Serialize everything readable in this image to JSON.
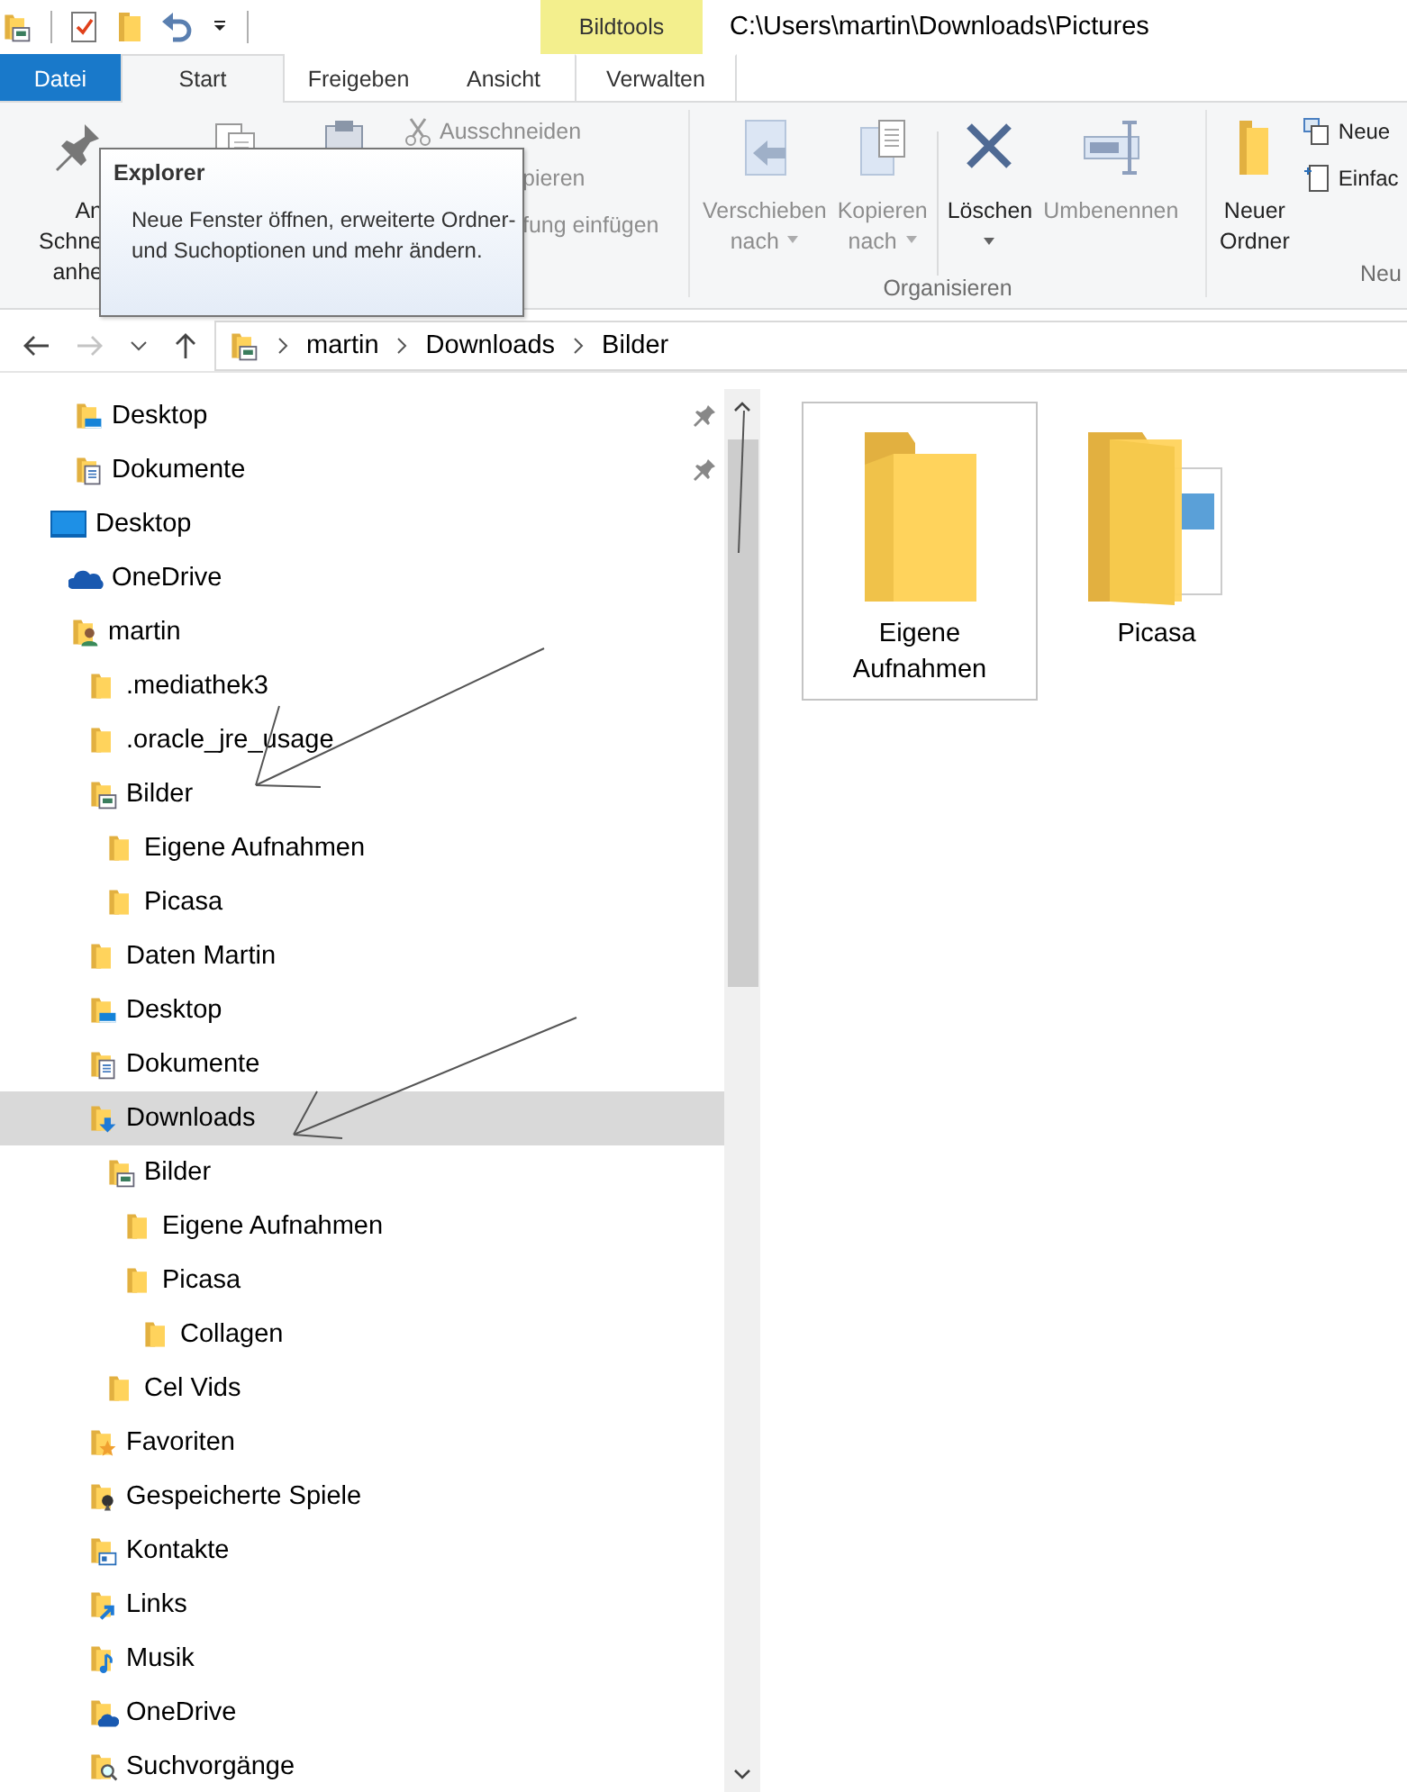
{
  "window": {
    "title": "C:\\Users\\martin\\Downloads\\Pictures"
  },
  "contextual_tab": {
    "label": "Bildtools"
  },
  "ribbon_tabs": [
    {
      "kind": "file",
      "label": "Datei",
      "selected": false
    },
    {
      "kind": "tab",
      "label": "Start",
      "selected": true
    },
    {
      "kind": "tab",
      "label": "Freigeben",
      "selected": false
    },
    {
      "kind": "tab",
      "label": "Ansicht",
      "selected": false
    },
    {
      "kind": "contextual",
      "label": "Verwalten",
      "selected": false
    }
  ],
  "ribbon": {
    "groups": [
      {
        "commands": [
          {
            "kind": "large",
            "label": "An Schne\nanhe",
            "disabled": false
          },
          {
            "kind": "large"
          },
          {
            "kind": "large"
          },
          {
            "kind": "stack",
            "items": [
              {
                "label": "Ausschneiden",
                "disabled": true
              },
              {
                "label": "pieren",
                "disabled": true
              },
              {
                "label": "fung einfügen",
                "disabled": true
              }
            ]
          }
        ]
      },
      {
        "label": "Organisieren",
        "commands": [
          {
            "kind": "large",
            "label": "Verschieben\nnach",
            "dropdown": true,
            "disabled": true
          },
          {
            "kind": "large",
            "label": "Kopieren\nnach",
            "dropdown": true,
            "disabled": true
          },
          {
            "kind": "separator"
          },
          {
            "kind": "large",
            "label": "Löschen",
            "dropdown": true,
            "disabled": false
          },
          {
            "kind": "large",
            "label": "Umbenennen",
            "disabled": true
          }
        ]
      },
      {
        "label": "Neu",
        "commands": [
          {
            "kind": "large",
            "label": "Neuer\nOrdner",
            "disabled": false
          },
          {
            "kind": "stack",
            "items": [
              {
                "label": "Neue",
                "disabled": false
              },
              {
                "label": "Einfac",
                "disabled": false
              }
            ]
          }
        ]
      }
    ]
  },
  "tooltip": {
    "title": "Explorer",
    "text": "Neue Fenster öffnen, erweiterte Ordner- und Suchoptionen und mehr ändern."
  },
  "navigation": {
    "back_disabled": false,
    "forward_disabled": true,
    "breadcrumbs": [
      "martin",
      "Downloads",
      "Bilder"
    ]
  },
  "nav_pane": {
    "quick_access": [
      {
        "label": "Desktop",
        "kind": "desktop-folder",
        "pinned": true,
        "selected": false
      },
      {
        "label": "Dokumente",
        "kind": "documents-folder",
        "pinned": true,
        "selected": false
      }
    ],
    "tree": [
      {
        "label": "Desktop",
        "kind": "monitor",
        "selected": false,
        "children": [
          {
            "label": "OneDrive",
            "kind": "cloud",
            "selected": false
          },
          {
            "label": "martin",
            "kind": "user-folder",
            "selected": false,
            "children": [
              {
                "label": ".mediathek3",
                "kind": "folder",
                "selected": false
              },
              {
                "label": ".oracle_jre_usage",
                "kind": "folder",
                "selected": false
              },
              {
                "label": "Bilder",
                "kind": "pictures-folder",
                "selected": false,
                "children": [
                  {
                    "label": "Eigene Aufnahmen",
                    "kind": "folder",
                    "selected": false
                  },
                  {
                    "label": "Picasa",
                    "kind": "folder",
                    "selected": false
                  }
                ]
              },
              {
                "label": "Daten Martin",
                "kind": "folder",
                "selected": false
              },
              {
                "label": "Desktop",
                "kind": "desktop-folder",
                "selected": false
              },
              {
                "label": "Dokumente",
                "kind": "documents-folder",
                "selected": false
              },
              {
                "label": "Downloads",
                "kind": "downloads-folder",
                "selected": true,
                "children": [
                  {
                    "label": "Bilder",
                    "kind": "pictures-folder",
                    "selected": false,
                    "children": [
                      {
                        "label": "Eigene Aufnahmen",
                        "kind": "folder",
                        "selected": false
                      },
                      {
                        "label": "Picasa",
                        "kind": "folder",
                        "selected": false,
                        "children": [
                          {
                            "label": "Collagen",
                            "kind": "folder",
                            "selected": false
                          }
                        ]
                      }
                    ]
                  },
                  {
                    "label": "Cel Vids",
                    "kind": "folder",
                    "selected": false
                  }
                ]
              },
              {
                "label": "Favoriten",
                "kind": "favorites-folder",
                "selected": false
              },
              {
                "label": "Gespeicherte Spiele",
                "kind": "games-folder",
                "selected": false
              },
              {
                "label": "Kontakte",
                "kind": "contacts-folder",
                "selected": false
              },
              {
                "label": "Links",
                "kind": "links-folder",
                "selected": false
              },
              {
                "label": "Musik",
                "kind": "music-folder",
                "selected": false
              },
              {
                "label": "OneDrive",
                "kind": "onedrive-folder",
                "selected": false
              },
              {
                "label": "Suchvorgänge",
                "kind": "search-folder",
                "selected": false
              }
            ]
          }
        ]
      }
    ]
  },
  "content": {
    "items": [
      {
        "name": "Eigene\nAufnahmen",
        "kind": "folder",
        "focused": true
      },
      {
        "name": "Picasa",
        "kind": "pictures-folder",
        "focused": false
      }
    ]
  }
}
